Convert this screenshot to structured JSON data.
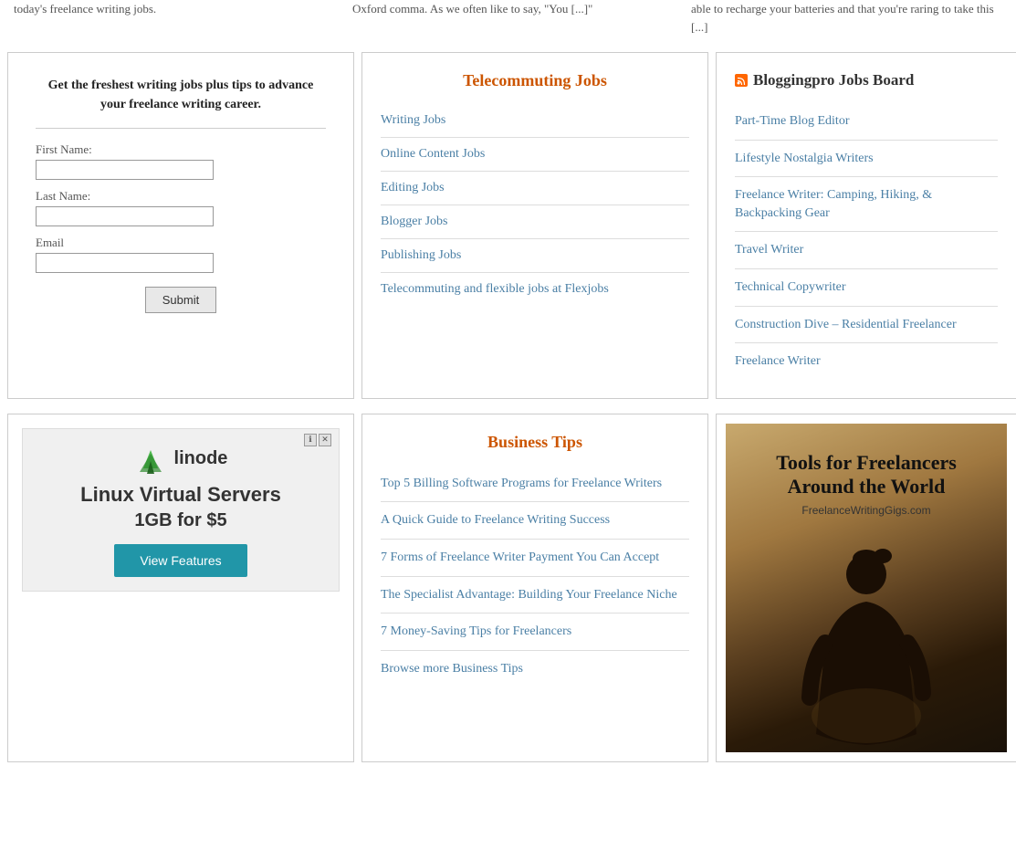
{
  "topStrip": {
    "col1": "today's freelance writing jobs.",
    "col2": "Oxford comma. As we often like to say, \"You [...]\"",
    "col3": "able to recharge your batteries and that you're raring to take this [...]"
  },
  "newsletter": {
    "headline": "Get the freshest writing jobs plus tips to advance your freelance writing career.",
    "firstNameLabel": "First Name:",
    "lastNameLabel": "Last Name:",
    "emailLabel": "Email",
    "submitLabel": "Submit"
  },
  "telecommutingJobs": {
    "title": "Telecommuting Jobs",
    "items": [
      {
        "label": "Writing Jobs",
        "href": "#"
      },
      {
        "label": "Online Content Jobs",
        "href": "#"
      },
      {
        "label": "Editing Jobs",
        "href": "#"
      },
      {
        "label": "Blogger Jobs",
        "href": "#"
      },
      {
        "label": "Publishing Jobs",
        "href": "#"
      },
      {
        "label": "Telecommuting and flexible jobs at Flexjobs",
        "href": "#"
      }
    ]
  },
  "bloggingproBoard": {
    "title": "Bloggingpro Jobs Board",
    "items": [
      {
        "label": "Part-Time Blog Editor",
        "href": "#"
      },
      {
        "label": "Lifestyle Nostalgia Writers",
        "href": "#"
      },
      {
        "label": "Freelance Writer: Camping, Hiking, & Backpacking Gear",
        "href": "#"
      },
      {
        "label": "Travel Writer",
        "href": "#"
      },
      {
        "label": "Technical Copywriter",
        "href": "#"
      },
      {
        "label": "Construction Dive – Residential Freelancer",
        "href": "#"
      },
      {
        "label": "Freelance Writer",
        "href": "#"
      }
    ]
  },
  "ad": {
    "brand": "linode",
    "headline": "Linux Virtual Servers",
    "subline": "1GB for $5",
    "ctaLabel": "View Features",
    "ctrlInfo": "ℹ",
    "ctrlClose": "✕"
  },
  "businessTips": {
    "title": "Business Tips",
    "items": [
      {
        "label": "Top 5 Billing Software Programs for Freelance Writers",
        "href": "#"
      },
      {
        "label": "A Quick Guide to Freelance Writing Success",
        "href": "#"
      },
      {
        "label": "7 Forms of Freelance Writer Payment You Can Accept",
        "href": "#"
      },
      {
        "label": "The Specialist Advantage: Building Your Freelance Niche",
        "href": "#"
      },
      {
        "label": "7 Money-Saving Tips for Freelancers",
        "href": "#"
      },
      {
        "label": "Browse more Business Tips",
        "href": "#"
      }
    ]
  },
  "toolsWidget": {
    "titleLine1": "Tools for Freelancers",
    "titleLine2": "Around the World",
    "subtitle": "FreelanceWritingGigs.com"
  }
}
